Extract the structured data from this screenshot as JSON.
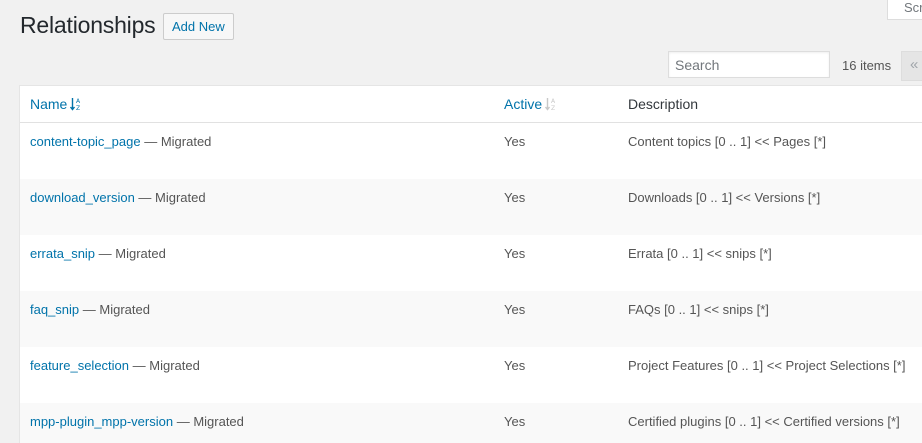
{
  "screen_options": {
    "label": "Scr"
  },
  "header": {
    "title": "Relationships",
    "add_new_label": "Add New"
  },
  "search": {
    "placeholder": "Search"
  },
  "pagination": {
    "count_label": "16 items",
    "first_label": "«"
  },
  "table": {
    "columns": {
      "name": "Name",
      "active": "Active",
      "description": "Description"
    },
    "separator": " — ",
    "rows": [
      {
        "slug": "content-topic_page",
        "status": "Migrated",
        "active": "Yes",
        "description": "Content topics [0 .. 1] << Pages [*]"
      },
      {
        "slug": "download_version",
        "status": "Migrated",
        "active": "Yes",
        "description": "Downloads [0 .. 1] << Versions [*]"
      },
      {
        "slug": "errata_snip",
        "status": "Migrated",
        "active": "Yes",
        "description": "Errata [0 .. 1] << snips [*]"
      },
      {
        "slug": "faq_snip",
        "status": "Migrated",
        "active": "Yes",
        "description": "FAQs [0 .. 1] << snips [*]"
      },
      {
        "slug": "feature_selection",
        "status": "Migrated",
        "active": "Yes",
        "description": "Project Features [0 .. 1] << Project Selections [*]"
      },
      {
        "slug": "mpp-plugin_mpp-version",
        "status": "Migrated",
        "active": "Yes",
        "description": "Certified plugins [0 .. 1] << Certified versions [*]"
      }
    ]
  },
  "colors": {
    "link": "#0073aa",
    "background": "#f1f1f1",
    "row_alt": "#f9f9f9"
  }
}
